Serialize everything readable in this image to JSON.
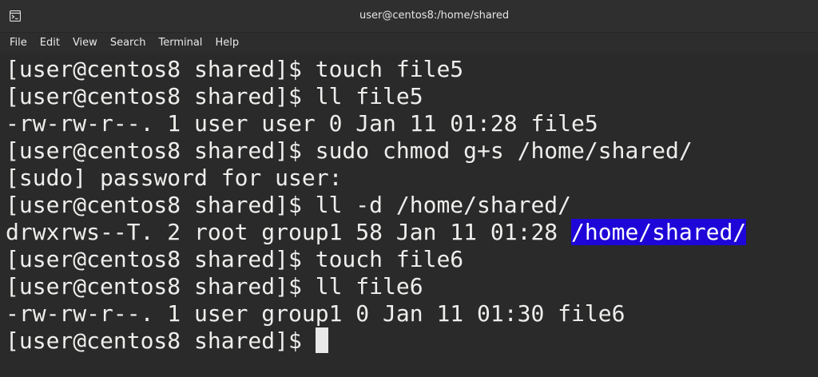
{
  "window": {
    "title": "user@centos8:/home/shared",
    "icon": "terminal-icon"
  },
  "menu": {
    "items": [
      "File",
      "Edit",
      "View",
      "Search",
      "Terminal",
      "Help"
    ]
  },
  "terminal": {
    "lines": [
      {
        "text": "[user@centos8 shared]$ touch file5"
      },
      {
        "text": "[user@centos8 shared]$ ll file5"
      },
      {
        "text": "-rw-rw-r--. 1 user user 0 Jan 11 01:28 file5"
      },
      {
        "text": "[user@centos8 shared]$ sudo chmod g+s /home/shared/"
      },
      {
        "text": "[sudo] password for user:"
      },
      {
        "text": "[user@centos8 shared]$ ll -d /home/shared/"
      },
      {
        "text": "drwxrws--T. 2 root group1 58 Jan 11 01:28 ",
        "highlight": "/home/shared/"
      },
      {
        "text": "[user@centos8 shared]$ touch file6"
      },
      {
        "text": "[user@centos8 shared]$ ll file6"
      },
      {
        "text": "-rw-rw-r--. 1 user group1 0 Jan 11 01:30 file6"
      },
      {
        "text": "[user@centos8 shared]$ ",
        "cursor": true
      }
    ],
    "colors": {
      "foreground": "#eeeeec",
      "background": "#2a2a2a",
      "highlight_bg": "#1f06d8",
      "highlight_fg": "#ffffff"
    }
  }
}
